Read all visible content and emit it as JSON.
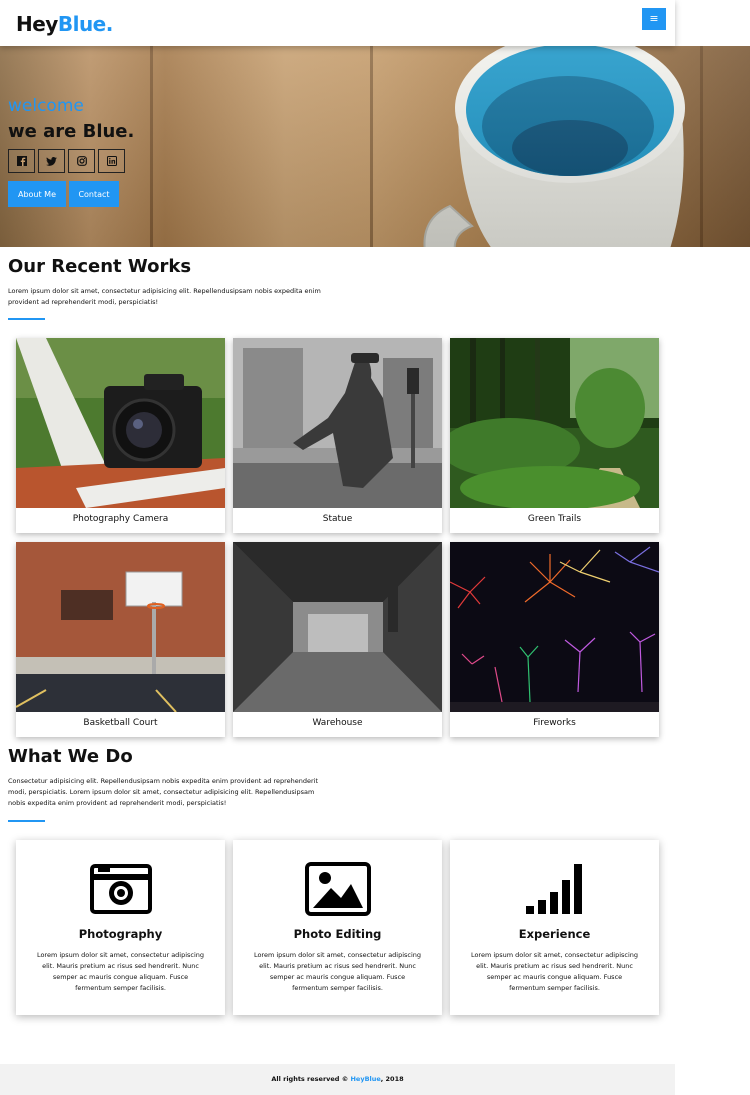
{
  "header": {
    "logo_part1": "Hey",
    "logo_part2": "Blue.",
    "menu_icon": "≡"
  },
  "hero": {
    "welcome": "welcome",
    "tagline": "we are Blue.",
    "socials": [
      "facebook-icon",
      "twitter-icon",
      "instagram-icon",
      "linkedin-icon"
    ],
    "buttons": [
      "About Me",
      "Contact"
    ]
  },
  "works": {
    "title": "Our Recent Works",
    "text": "Lorem ipsum dolor sit amet, consectetur adipisicing elit. Repellendusipsam nobis expedita enim provident ad reprehenderit modi, perspiciatis!",
    "items": [
      {
        "caption": "Photography Camera"
      },
      {
        "caption": "Statue"
      },
      {
        "caption": "Green Trails"
      },
      {
        "caption": "Basketball Court"
      },
      {
        "caption": "Warehouse"
      },
      {
        "caption": "Fireworks"
      }
    ]
  },
  "services": {
    "title": "What We Do",
    "text": "Consectetur adipisicing elit. Repellendusipsam nobis expedita enim provident ad reprehenderit modi, perspiciatis. Lorem ipsum dolor sit amet, consectetur adipisicing elit. Repellendusipsam nobis expedita enim provident ad reprehenderit modi, perspiciatis!",
    "items": [
      {
        "icon": "camera-icon",
        "title": "Photography",
        "desc": "Lorem ipsum dolor sit amet, consectetur adipiscing elit. Mauris pretium ac risus sed hendrerit. Nunc semper ac mauris congue aliquam. Fusce fermentum semper facilisis."
      },
      {
        "icon": "image-icon",
        "title": "Photo Editing",
        "desc": "Lorem ipsum dolor sit amet, consectetur adipiscing elit. Mauris pretium ac risus sed hendrerit. Nunc semper ac mauris congue aliquam. Fusce fermentum semper facilisis."
      },
      {
        "icon": "signal-bars-icon",
        "title": "Experience",
        "desc": "Lorem ipsum dolor sit amet, consectetur adipiscing elit. Mauris pretium ac risus sed hendrerit. Nunc semper ac mauris congue aliquam. Fusce fermentum semper facilisis."
      }
    ]
  },
  "footer": {
    "prefix": "All rights reserved © ",
    "brand": "HeyBlue",
    "suffix": ", 2018"
  },
  "colors": {
    "accent": "#2196f3",
    "text": "#111111",
    "footer_bg": "#f2f2f2"
  }
}
